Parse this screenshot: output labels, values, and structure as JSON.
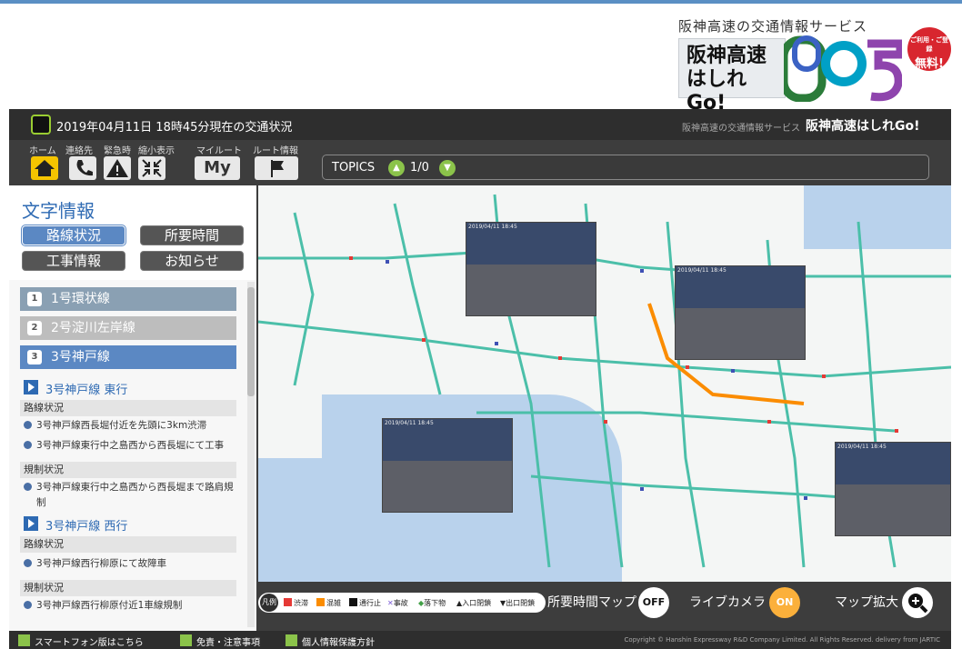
{
  "brand": {
    "tagline": "阪神高速の交通情報サービス",
    "name_line1": "阪神高速",
    "name_line2": "はしれGo!",
    "free_small": "ご利用・ご登録",
    "free_big": "無料!"
  },
  "titlebar": {
    "datetime": "2019年04月11日 18時45分現在の交通状況",
    "service_sub": "阪神高速の交通情報サービス",
    "service_name": "阪神高速はしれGo!"
  },
  "toolbar": {
    "home_label": "ホーム",
    "contact_label": "連絡先",
    "emergency_label": "緊急時",
    "shrink_label": "縮小表示",
    "myroute_label": "マイルート",
    "route_info_label": "ルート情報",
    "my_btn": "My",
    "topics_label": "TOPICS",
    "topics_count": "1/0"
  },
  "sidebar": {
    "title": "文字情報",
    "tabs": [
      "路線状況",
      "所要時間",
      "工事情報",
      "お知らせ"
    ],
    "lines": [
      {
        "num": "1",
        "label": "1号環状線",
        "color": "#8aa0b3"
      },
      {
        "num": "2",
        "label": "2号淀川左岸線",
        "color": "#bdbdbd"
      },
      {
        "num": "3",
        "label": "3号神戸線",
        "color": "#5b88c3"
      }
    ],
    "east": {
      "heading": "3号神戸線 東行",
      "status_title": "路線状況",
      "status_items": [
        "3号神戸線西長堀付近を先頭に3km渋滞",
        "3号神戸線東行中之島西から西長堀にて工事"
      ],
      "reg_title": "規制状況",
      "reg_items": [
        "3号神戸線東行中之島西から西長堀まで路肩規制"
      ]
    },
    "west": {
      "heading": "3号神戸線 西行",
      "status_title": "路線状況",
      "status_items": [
        "3号神戸線西行柳原にて故障車"
      ],
      "reg_title": "規制状況",
      "reg_items": [
        "3号神戸線西行柳原付近1車線規制"
      ]
    }
  },
  "map": {
    "camera_stamps": [
      "2019/04/11 18:45",
      "2019/04/11 18:45",
      "2019/04/11 18:45",
      "2019/04/11 18:45"
    ]
  },
  "legend": {
    "tag": "凡例",
    "items": [
      {
        "label": "渋滞",
        "color": "#e53935"
      },
      {
        "label": "混雑",
        "color": "#fb8c00"
      },
      {
        "label": "通行止",
        "color": "#111111"
      },
      {
        "label": "事故",
        "color": "#7b5bd6"
      },
      {
        "label": "落下物",
        "color": "#43a047"
      },
      {
        "label": "入口閉鎖",
        "color": "#111111"
      },
      {
        "label": "出口閉鎖",
        "color": "#111111"
      }
    ]
  },
  "controls": {
    "travel_map_label": "所要時間マップ",
    "travel_map_state": "OFF",
    "live_camera_label": "ライブカメラ",
    "live_camera_state": "ON",
    "zoom_label": "マップ拡大"
  },
  "footer": {
    "smartphone": "スマートフォン版はこちら",
    "disclaimer": "免責・注意事項",
    "privacy": "個人情報保護方針",
    "copyright": "Copyright © Hanshin Expressway R&D Company Limited. All Rights Reserved. delivery from JARTIC"
  }
}
